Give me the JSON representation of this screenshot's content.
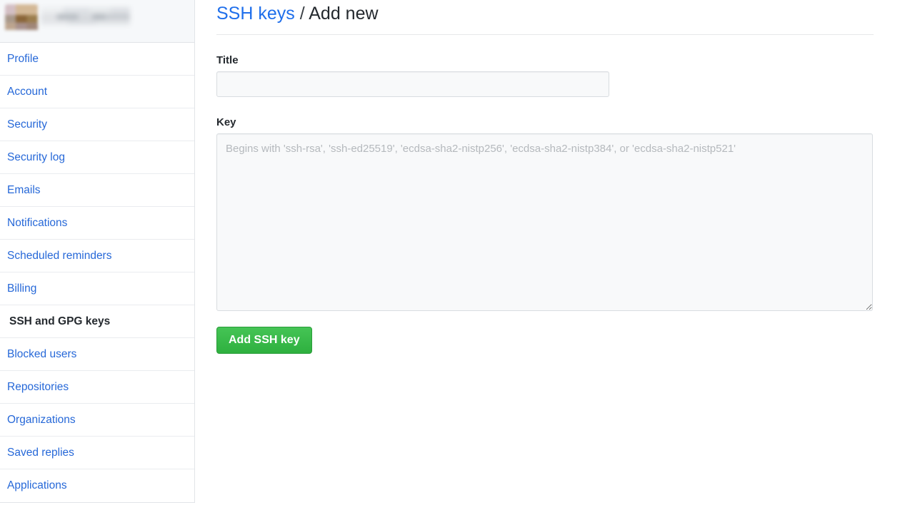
{
  "sidebar": {
    "account_switcher": {
      "avatar_alt": "user-avatar-blurred",
      "username_alt": "username-blurred"
    },
    "items": [
      {
        "label": "Profile",
        "selected": false
      },
      {
        "label": "Account",
        "selected": false
      },
      {
        "label": "Security",
        "selected": false
      },
      {
        "label": "Security log",
        "selected": false
      },
      {
        "label": "Emails",
        "selected": false
      },
      {
        "label": "Notifications",
        "selected": false
      },
      {
        "label": "Scheduled reminders",
        "selected": false
      },
      {
        "label": "Billing",
        "selected": false
      },
      {
        "label": "SSH and GPG keys",
        "selected": true
      },
      {
        "label": "Blocked users",
        "selected": false
      },
      {
        "label": "Repositories",
        "selected": false
      },
      {
        "label": "Organizations",
        "selected": false
      },
      {
        "label": "Saved replies",
        "selected": false
      },
      {
        "label": "Applications",
        "selected": false
      }
    ]
  },
  "header": {
    "breadcrumb_link": "SSH keys",
    "breadcrumb_separator": "/",
    "breadcrumb_current": "Add new"
  },
  "form": {
    "title_label": "Title",
    "title_value": "",
    "title_placeholder": "",
    "key_label": "Key",
    "key_value": "",
    "key_placeholder": "Begins with 'ssh-rsa', 'ssh-ed25519', 'ecdsa-sha2-nistp256', 'ecdsa-sha2-nistp384', or 'ecdsa-sha2-nistp521'",
    "submit_label": "Add SSH key"
  },
  "colors": {
    "link_blue": "#2668d8",
    "breadcrumb_blue": "#1f6feb",
    "selected_border_orange": "#e36209",
    "button_green": "#2eb03f",
    "text_dark": "#24292e",
    "border_gray": "#e1e4e8",
    "input_bg": "#f8f9fa"
  }
}
